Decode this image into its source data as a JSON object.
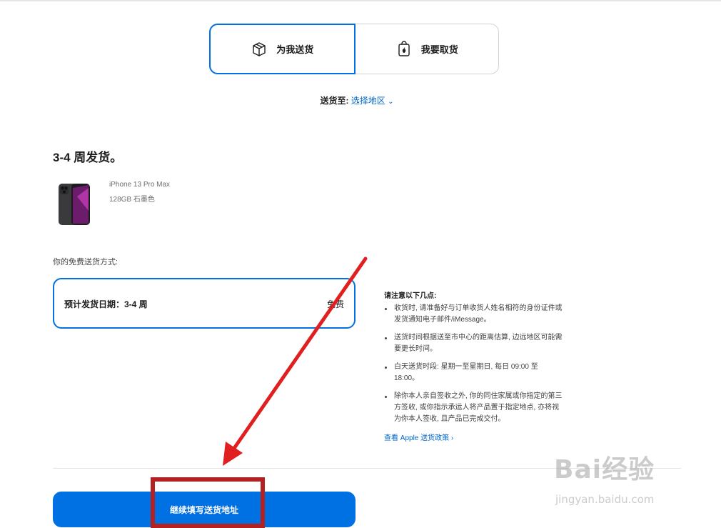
{
  "delivery_options": {
    "ship_label": "为我送货",
    "pickup_label": "我要取货"
  },
  "ship_to": {
    "label": "送货至:",
    "link": "选择地区"
  },
  "shipping_heading": "3-4 周发货。",
  "product": {
    "name": "iPhone 13 Pro Max",
    "spec": "128GB 石墨色"
  },
  "free_shipping_label": "你的免费送货方式:",
  "method": {
    "text": "预计发货日期：3-4 周",
    "cost": "免费"
  },
  "notes": {
    "title": "请注意以下几点:",
    "items": [
      "收货时, 请准备好与订单收货人姓名相符的身份证件或发货通知电子邮件/iMessage。",
      "送货时间根据送至市中心的距离估算, 边远地区可能需要更长时间。",
      "白天送货时段: 星期一至星期日, 每日 09:00 至 18:00。",
      "除你本人亲自签收之外, 你的同住家属或你指定的第三方签收, 或你指示承运人将产品置于指定地点, 亦将视为你本人签收, 且产品已完成交付。"
    ],
    "link": "查看 Apple 送货政策 ›"
  },
  "continue_button": "继续填写送货地址",
  "watermark": {
    "logo": "Bai经验",
    "url": "jingyan.baidu.com"
  },
  "colors": {
    "accent": "#0071e3",
    "link": "#0066cc",
    "annotation": "#e02020",
    "highlight_box": "#b22222"
  }
}
